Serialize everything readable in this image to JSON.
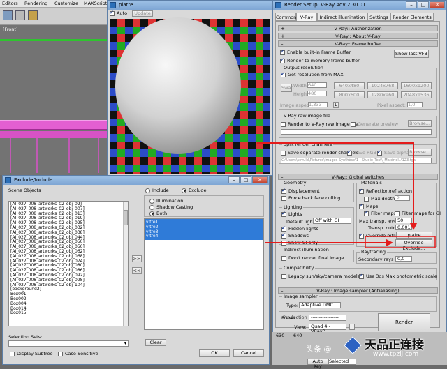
{
  "max_menu": [
    "Editors",
    "Rendering",
    "Customize",
    "MAXScript"
  ],
  "viewport": {
    "label": "[Front]"
  },
  "material_window": {
    "title": "platre",
    "auto_label": "Auto",
    "update_label": "Update"
  },
  "render_setup": {
    "title": "Render Setup: V-Ray Adv 2.30.01",
    "tabs": [
      "Common",
      "V-Ray",
      "Indirect illumination",
      "Settings",
      "Render Elements"
    ],
    "rollouts": {
      "authorization": "V-Ray:: Authorization",
      "about": "V-Ray:: About V-Ray",
      "frame_buffer": "V-Ray:: Frame buffer",
      "global_switches": "V-Ray:: Global switches",
      "image_sampler": "V-Ray:: Image sampler (Antialiasing)"
    },
    "frame_buffer": {
      "enable_builtin": "Enable built-in Frame Buffer",
      "show_last_vfb": "Show last VFB",
      "render_to_memory": "Render to memory frame buffer",
      "output_resolution": "Output resolution",
      "get_res_from_max": "Get resolution from MAX",
      "swap": "Swap",
      "width_label": "Width",
      "width_value": "640",
      "height_label": "Height",
      "height_value": "480",
      "presets": [
        "640x480",
        "1024x768",
        "1600x1200",
        "800x600",
        "1280x960",
        "2048x1536"
      ],
      "image_aspect_label": "Image aspect:",
      "image_aspect_value": "1,333",
      "lock_label": "L",
      "pixel_aspect_label": "Pixel aspect:",
      "pixel_aspect_value": "1,0",
      "raw_image_group": "V-Ray raw image file",
      "render_to_raw": "Render to V-Ray raw image file",
      "generate_preview": "Generate preview",
      "browse_label": "Browse...",
      "split_channels_group": "Split render channels",
      "save_separate": "Save separate render channels",
      "save_rgb": "Save RGB",
      "save_alpha": "Save alpha",
      "path_value": "C:\\Users\\sevuld\\Pictures\\Images Synthèse\\1 - Studio_Test\\_Matériel..\\123.tga"
    },
    "global_switches": {
      "geometry_group": "Geometry",
      "displacement": "Displacement",
      "force_back_face": "Force back face culling",
      "lighting_group": "Lighting",
      "lights": "Lights",
      "default_lights_label": "Default lights",
      "default_lights_value": "Off with GI",
      "hidden_lights": "Hidden lights",
      "shadows": "Shadows",
      "show_gi_only": "Show GI only",
      "indirect_group": "Indirect illumination",
      "dont_render_final": "Don't render final image",
      "compat_group": "Compatibility",
      "legacy_sun": "Legacy sun/sky/camera models",
      "use_3dsmax_photometric": "Use 3ds Max photometric scale",
      "materials_group": "Materials",
      "reflection_refraction": "Reflection/refraction",
      "max_depth_label": "Max depth",
      "max_depth_value": "2",
      "maps": "Maps",
      "filter_maps": "Filter maps",
      "filter_maps_gi": "Filter maps for GI",
      "max_transp_label": "Max transp. levels",
      "max_transp_value": "50",
      "transp_cutoff_label": "Transp. cutoff",
      "transp_cutoff_value": "0,001",
      "override_mtl": "Override mtl:",
      "override_mtl_value": "platre",
      "override_exclude": "Override Exclude...",
      "raytracing_group": "Raytracing",
      "secondary_rays_label": "Secondary rays bias",
      "secondary_rays_value": "0,0"
    },
    "image_sampler": {
      "group": "Image sampler",
      "type_label": "Type:",
      "type_value": "Adaptive DMC"
    },
    "bottom": {
      "production_label": "Production",
      "preset_label": "Preset:",
      "preset_value": "-----------------",
      "view_label": "View:",
      "view_value": "Quad 4 - VRayP",
      "render_button": "Render"
    }
  },
  "exclude_dialog": {
    "title": "Exclude/Include",
    "scene_objects_label": "Scene Objects",
    "objects": [
      "[AI_027_008_artworks_02_obj_02]",
      "[AI_027_008_artworks_02_obj_007]",
      "[AI_027_008_artworks_02_obj_013]",
      "[AI_027_008_artworks_02_obj_019]",
      "[AI_027_008_artworks_02_obj_025]",
      "[AI_027_008_artworks_02_obj_032]",
      "[AI_027_008_artworks_02_obj_038]",
      "[AI_027_008_artworks_02_obj_044]",
      "[AI_027_008_artworks_02_obj_050]",
      "[AI_027_008_artworks_02_obj_056]",
      "[AI_027_008_artworks_02_obj_062]",
      "[AI_027_008_artworks_02_obj_068]",
      "[AI_027_008_artworks_02_obj_074]",
      "[AI_027_008_artworks_02_obj_080]",
      "[AI_027_008_artworks_02_obj_086]",
      "[AI_027_008_artworks_02_obj_092]",
      "[AI_027_008_artworks_02_obj_098]",
      "[AI_027_008_artworks_02_obj_104]",
      "[background2]",
      "Box001",
      "Box002",
      "Box004",
      "Box014",
      "Box015"
    ],
    "include_label": "Include",
    "exclude_label": "Exclude",
    "illumination_label": "Illumination",
    "shadow_casting_label": "Shadow Casting",
    "both_label": "Both",
    "excluded_items": [
      "vitre1",
      "vitre2",
      "vitre3",
      "vitre4"
    ],
    "move_right": ">>",
    "move_left": "<<",
    "selection_sets_label": "Selection Sets:",
    "display_subtree": "Display Subtree",
    "case_sensitive": "Case Sensitive",
    "clear_button": "Clear",
    "ok_button": "OK",
    "cancel_button": "Cancel"
  },
  "footer": {
    "coord": "630",
    "coord2": "640",
    "auto_key": "Auto Key",
    "selected": "Selected"
  },
  "watermark": {
    "prefix": "头条 @",
    "brand": "天品正连接",
    "url": "www.tpzlj.com"
  }
}
